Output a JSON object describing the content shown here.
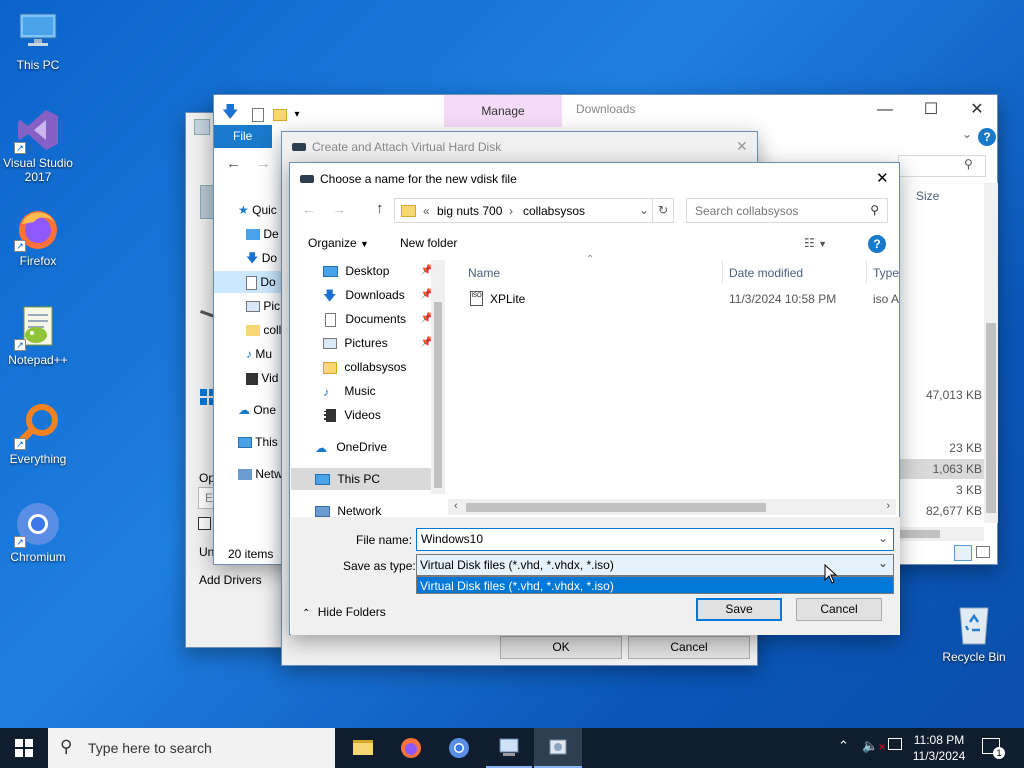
{
  "desktop": {
    "icons": [
      {
        "label": "This PC"
      },
      {
        "label": "Visual Studio 2017"
      },
      {
        "label": "Firefox"
      },
      {
        "label": "Notepad++"
      },
      {
        "label": "Everything"
      },
      {
        "label": "Chromium"
      },
      {
        "label": "Recycle Bin"
      }
    ]
  },
  "explorer": {
    "tab_manage": "Manage",
    "title": "Downloads",
    "file_tab": "File",
    "nav": [
      "Quic",
      "De",
      "Do",
      "Do",
      "Pic",
      "coll",
      "Mu",
      "Vid",
      "One",
      "This",
      "Netw"
    ],
    "size_header": "Size",
    "sizes": [
      "47,013 KB",
      "23 KB",
      "1,063 KB",
      "3 KB",
      "82,677 KB"
    ],
    "status": "20 items"
  },
  "behind_dialog": {
    "frag_op": "Op",
    "frag_ed": "Ed",
    "frag_un": "Un",
    "add_drivers": "Add Drivers"
  },
  "attach_dialog": {
    "title": "Create and Attach Virtual Hard Disk",
    "ok": "OK",
    "cancel": "Cancel"
  },
  "save_dialog": {
    "title": "Choose a name for the new vdisk file",
    "breadcrumb": {
      "prefix": "«",
      "parent": "big nuts 700",
      "current": "collabsysos"
    },
    "search_placeholder": "Search collabsysos",
    "organize": "Organize",
    "new_folder": "New folder",
    "nav": [
      {
        "label": "Desktop",
        "icon": "desktop-icon",
        "pinned": true
      },
      {
        "label": "Downloads",
        "icon": "download-icon",
        "pinned": true
      },
      {
        "label": "Documents",
        "icon": "document-icon",
        "pinned": true
      },
      {
        "label": "Pictures",
        "icon": "picture-icon",
        "pinned": true
      },
      {
        "label": "collabsysos",
        "icon": "folder-icon",
        "pinned": false
      },
      {
        "label": "Music",
        "icon": "music-icon",
        "pinned": false
      },
      {
        "label": "Videos",
        "icon": "video-icon",
        "pinned": false
      },
      {
        "label": "OneDrive",
        "icon": "cloud-icon",
        "pinned": false
      },
      {
        "label": "This PC",
        "icon": "computer-icon",
        "pinned": false
      },
      {
        "label": "Network",
        "icon": "network-icon",
        "pinned": false
      }
    ],
    "columns": {
      "name": "Name",
      "date": "Date modified",
      "type": "Type"
    },
    "files": [
      {
        "name": "XPLite",
        "date": "11/3/2024 10:58 PM",
        "type": "iso A"
      }
    ],
    "file_name_label": "File name:",
    "file_name_value": "Windows10",
    "save_type_label": "Save as type:",
    "save_type_value": "Virtual Disk files (*.vhd, *.vhdx, *.iso)",
    "save_type_option": "Virtual Disk files (*.vhd, *.vhdx, *.iso)",
    "hide_folders": "Hide Folders",
    "save": "Save",
    "cancel": "Cancel"
  },
  "taskbar": {
    "search_placeholder": "Type here to search",
    "time": "11:08 PM",
    "date": "11/3/2024",
    "notification_count": "1"
  },
  "colors": {
    "accent": "#0078d7",
    "selection": "#cce8ff",
    "taskbar": "#0f1d2e"
  }
}
